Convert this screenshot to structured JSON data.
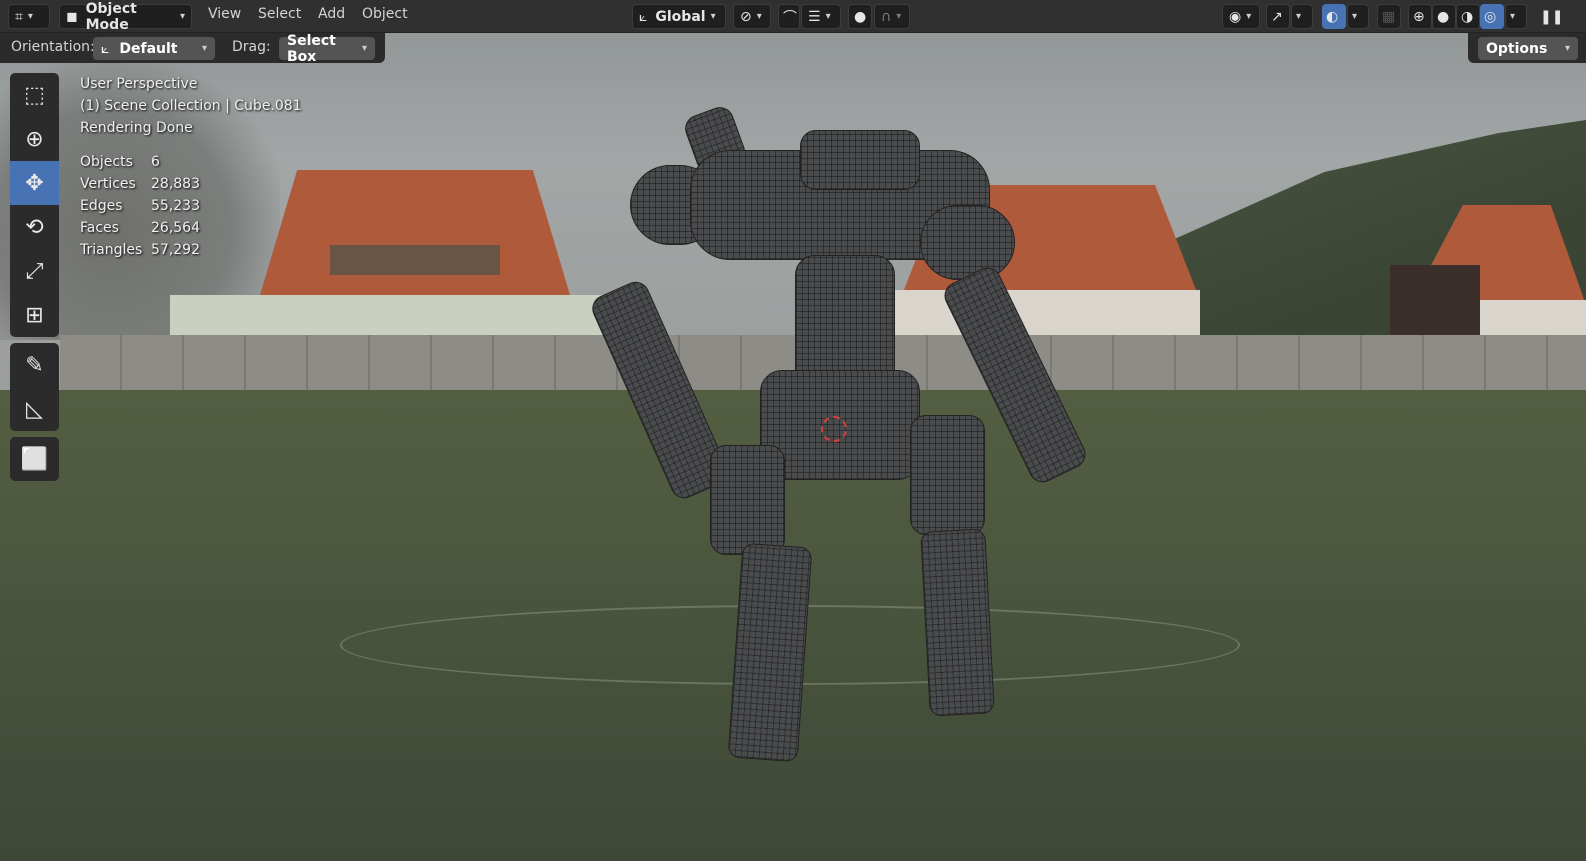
{
  "header": {
    "editor_type_icon": "editor-type-icon",
    "mode": "Object Mode",
    "menus": [
      "View",
      "Select",
      "Add",
      "Object"
    ],
    "transform_orientation": "Global",
    "pivot_icon": "pivot-icon",
    "snap_icon": "snap-icon",
    "proportional_icon": "proportional-editing-icon"
  },
  "tool_settings": {
    "orientation_label": "Orientation:",
    "orientation_value": "Default",
    "drag_label": "Drag:",
    "drag_value": "Select Box",
    "options_label": "Options"
  },
  "tools": [
    {
      "name": "select-box-icon",
      "glyph": "⬚"
    },
    {
      "name": "cursor-icon",
      "glyph": "⊕"
    },
    {
      "name": "move-icon",
      "glyph": "✥"
    },
    {
      "name": "rotate-icon",
      "glyph": "⟲"
    },
    {
      "name": "scale-icon",
      "glyph": "⤢"
    },
    {
      "name": "transform-icon",
      "glyph": "⊞"
    },
    {
      "name": "annotate-icon",
      "glyph": "✎"
    },
    {
      "name": "measure-icon",
      "glyph": "📐"
    },
    {
      "name": "add-cube-icon",
      "glyph": "⬜"
    }
  ],
  "overlay": {
    "view_name": "User Perspective",
    "collection": "(1) Scene Collection | Cube.081",
    "status": "Rendering Done"
  },
  "stats": [
    {
      "label": "Objects",
      "value": "6"
    },
    {
      "label": "Vertices",
      "value": "28,883"
    },
    {
      "label": "Edges",
      "value": "55,233"
    },
    {
      "label": "Faces",
      "value": "26,564"
    },
    {
      "label": "Triangles",
      "value": "57,292"
    }
  ],
  "colors": {
    "accent": "#4772b3",
    "header_bg": "#303030",
    "cursor_ring": "#d8403a"
  }
}
